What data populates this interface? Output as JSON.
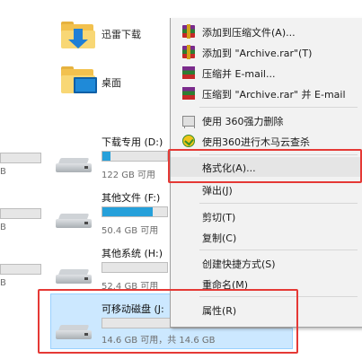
{
  "explorer": {
    "folders": [
      {
        "name": "迅雷下载",
        "icon": "download-folder-icon"
      },
      {
        "name": "桌面",
        "icon": "desktop-folder-icon"
      }
    ],
    "left_partial": [
      {
        "capacity": "B",
        "used_fraction": 0.0
      },
      {
        "capacity": "B",
        "used_fraction": 0.0
      },
      {
        "capacity": "B",
        "used_fraction": 0.0
      }
    ],
    "drives": [
      {
        "name": "下载专用 (D:)",
        "capacity": "122 GB 可用",
        "used_fraction": 0.12
      },
      {
        "name": "其他文件 (F:)",
        "capacity": "50.4 GB 可用",
        "used_fraction": 0.78
      },
      {
        "name": "其他系统 (H:)",
        "capacity": "52.4 GB 可用",
        "used_fraction": 0.0
      },
      {
        "name": "可移动磁盘 (J:",
        "capacity": "14.6 GB 可用，共 14.6 GB",
        "used_fraction": 0.0
      }
    ]
  },
  "context_menu": {
    "items": [
      {
        "label": "添加到压缩文件(A)...",
        "icon": "winrar-icon"
      },
      {
        "label": "添加到 \"Archive.rar\"(T)",
        "icon": "winrar-icon"
      },
      {
        "label": "压缩并 E-mail...",
        "icon": "winrar-email-icon"
      },
      {
        "label": "压缩到 \"Archive.rar\" 并 E-mail",
        "icon": "winrar-email-icon"
      },
      {
        "label": "使用 360强力删除",
        "icon": "shredder-icon"
      },
      {
        "label": "使用360进行木马云查杀",
        "icon": "360-scan-icon"
      },
      {
        "label": "格式化(A)...",
        "icon": ""
      },
      {
        "label": "弹出(J)",
        "icon": ""
      },
      {
        "label": "剪切(T)",
        "icon": ""
      },
      {
        "label": "复制(C)",
        "icon": ""
      },
      {
        "label": "创建快捷方式(S)",
        "icon": ""
      },
      {
        "label": "重命名(M)",
        "icon": ""
      },
      {
        "label": "属性(R)",
        "icon": ""
      }
    ]
  },
  "colors": {
    "accent_bar": "#26a0da",
    "annotation_red": "#e53935",
    "selection": "#cce8ff"
  }
}
